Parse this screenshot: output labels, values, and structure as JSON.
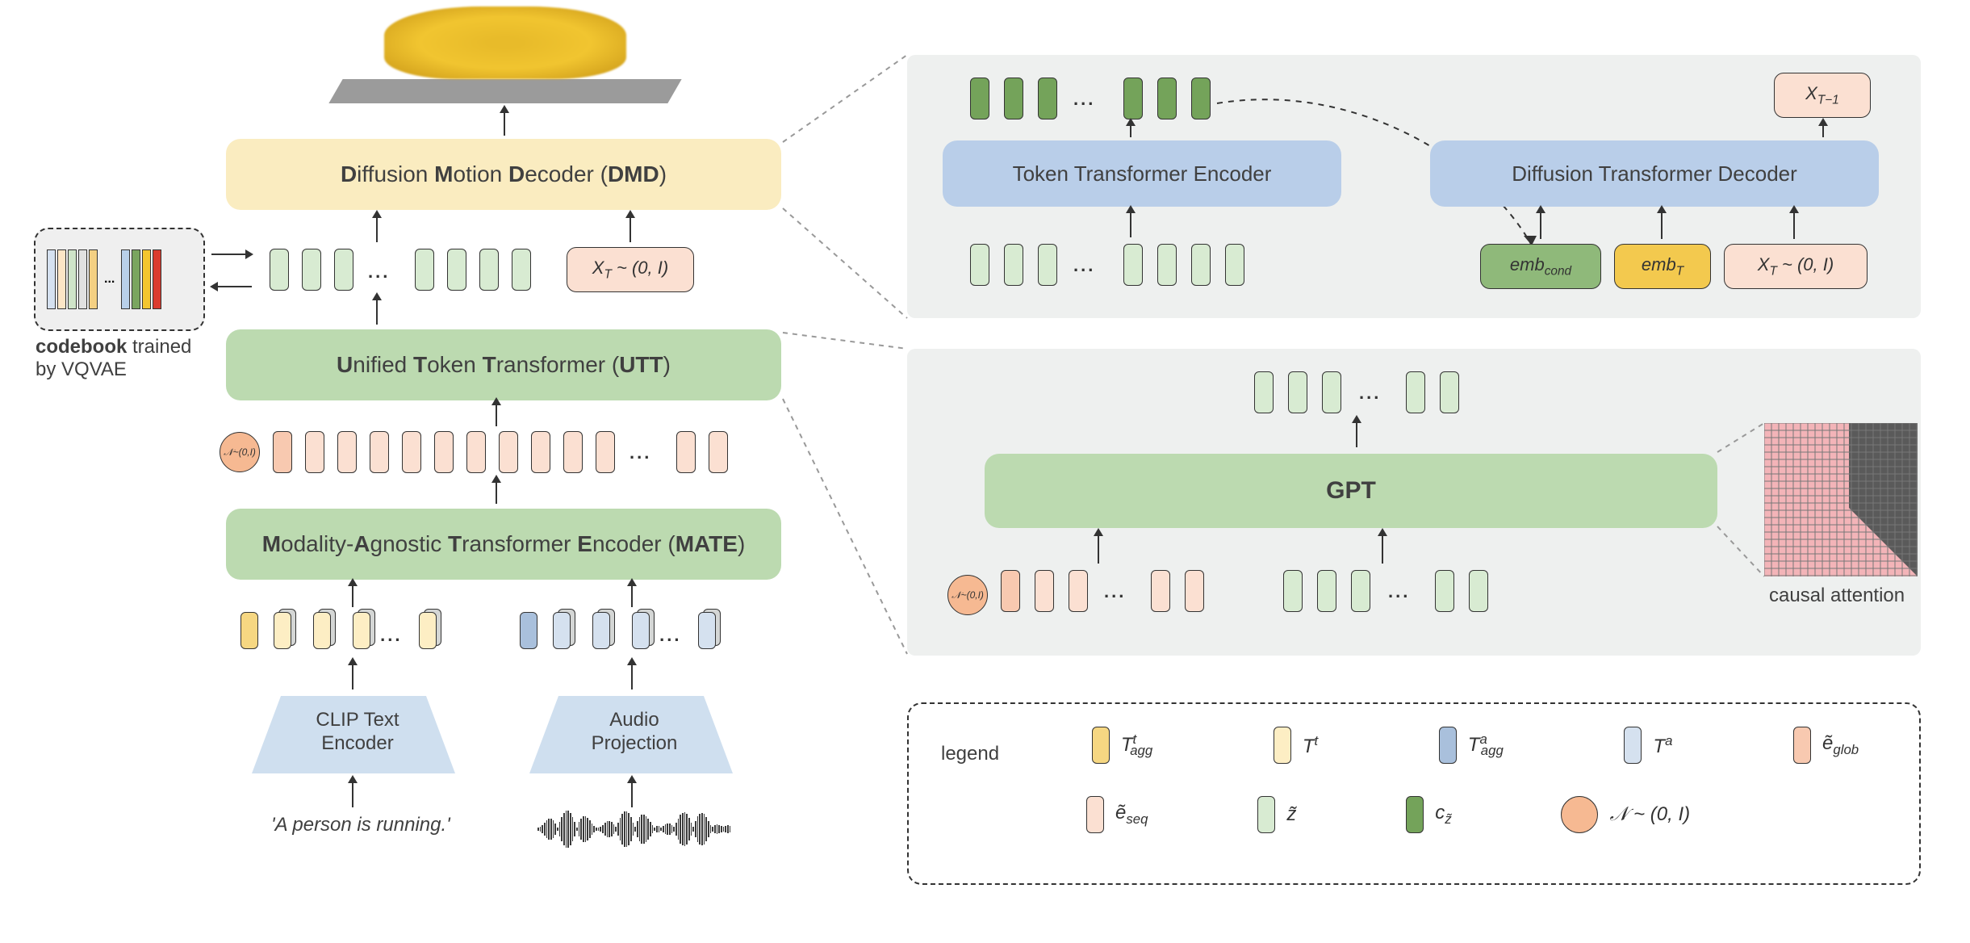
{
  "blocks": {
    "dmd": "Diffusion Motion Decoder (DMD)",
    "dmd_bold": {
      "d": "D",
      "m": "M",
      "d2": "D"
    },
    "utt": "Unified Token Transformer (UTT)",
    "mate": "Modality-Agnostic Transformer Encoder (MATE)",
    "token_enc": "Token Transformer Encoder",
    "diff_dec": "Diffusion Transformer Decoder",
    "gpt": "GPT",
    "clip": "CLIP Text\nEncoder",
    "audio": "Audio\nProjection",
    "codebook_label_1": "codebook",
    "codebook_label_2": " trained",
    "codebook_label_3": "by VQVAE"
  },
  "chips": {
    "xt_noise": "X_T ~ (0, I)",
    "xt_noise2": "X_T ~ (0, I)",
    "xt_minus1": "X_{T-1}",
    "emb_cond": "emb_cond",
    "emb_t": "emb_T"
  },
  "labels": {
    "input_text": "'A person is running.'",
    "causal": "causal attention",
    "noise_circle": "𝒩~(0,I)"
  },
  "legend": {
    "title": "legend",
    "items": [
      {
        "color": "t-yellow",
        "text": "T^t_agg"
      },
      {
        "color": "t-yellow-light",
        "text": "T^t"
      },
      {
        "color": "t-blue",
        "text": "T^a_agg"
      },
      {
        "color": "t-blue-light",
        "text": "T^a"
      },
      {
        "color": "t-peach",
        "text": "ẽ_glob"
      },
      {
        "color": "t-peach-light",
        "text": "ẽ_seq"
      },
      {
        "color": "t-green",
        "text": "z̃"
      },
      {
        "color": "t-green-dark",
        "text": "c_z̃"
      },
      {
        "color": "circle",
        "text": "𝒩~(0,I)"
      }
    ]
  }
}
